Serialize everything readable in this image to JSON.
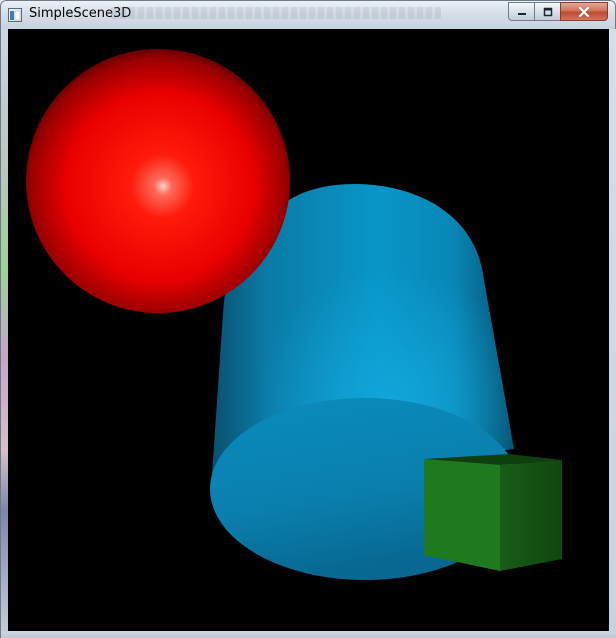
{
  "window": {
    "title": "SimpleScene3D",
    "icon": "app-window-icon",
    "controls": {
      "minimize_icon": "minimize-icon",
      "maximize_icon": "maximize-icon",
      "close_icon": "close-icon"
    }
  },
  "scene": {
    "background_color": "#000000",
    "objects": [
      {
        "name": "sphere",
        "color": "#ff0000"
      },
      {
        "name": "cylinder",
        "color": "#0a8fc0"
      },
      {
        "name": "cube",
        "color": "#1f7a1f"
      }
    ]
  }
}
